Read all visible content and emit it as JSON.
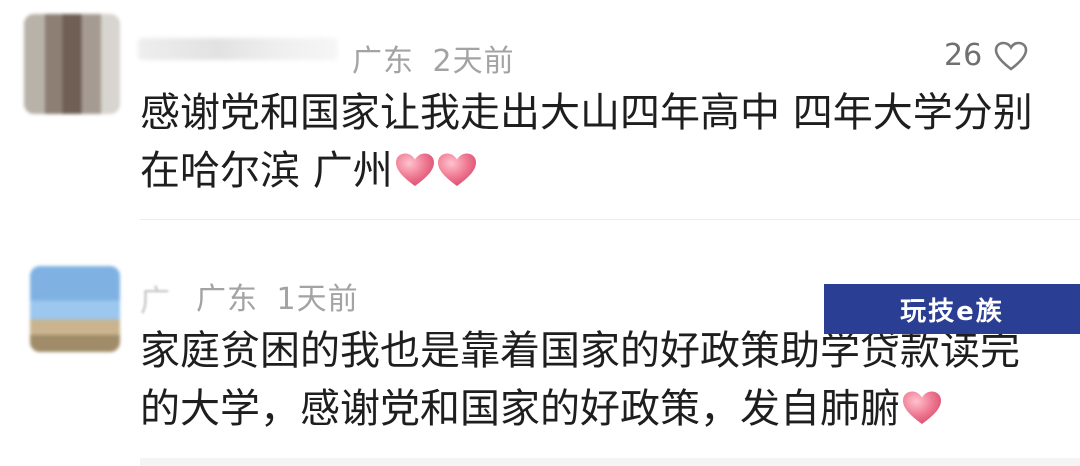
{
  "comments": [
    {
      "location": "广东",
      "time": "2天前",
      "likes": "26",
      "text_line1": "感谢党和国家让我走出大山四年高中 四年大学分别",
      "text_line2": "在哈尔滨 广州",
      "emoji": [
        "heart-emoji",
        "heart-emoji"
      ]
    },
    {
      "location": "广东",
      "time": "1天前",
      "name_partial": "广",
      "text_line1": "家庭贫困的我也是靠着国家的好政策助学贷款读完",
      "text_line2": "的大学，感谢党和国家的好政策，发自肺腑",
      "emoji": [
        "heart-emoji"
      ]
    }
  ],
  "watermark": "玩技e族",
  "icons": {
    "like": "heart-outline-icon"
  },
  "colors": {
    "text": "#1e1e1e",
    "meta": "#a3a3a3",
    "watermark_bg": "#2a3f93",
    "heart": "#e86a85"
  }
}
